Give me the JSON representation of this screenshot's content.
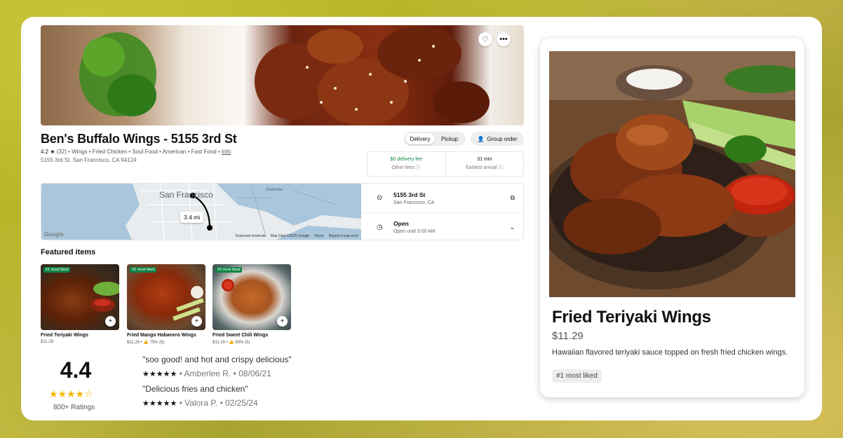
{
  "restaurant": {
    "title": "Ben's Buffalo Wings - 5155 3rd St",
    "rating": "4.2 ★",
    "review_count": "(32)",
    "categories": "• Wings • Fried Chicken • Soul Food • American • Fast Food •",
    "info_link": "Info",
    "address": "5155 3rd St, San Francisco, CA 94124"
  },
  "hero": {
    "favorite_icon": "heart-icon",
    "more_icon": "more-icon"
  },
  "order_mode": {
    "delivery": "Delivery",
    "pickup": "Pickup",
    "selected": "Delivery"
  },
  "group_order": {
    "label": "Group order",
    "icon": "add-person-icon"
  },
  "fees": {
    "delivery_fee": "$0 delivery fee",
    "other_fees": "Other fees",
    "time": "31 min",
    "time_label": "Earliest arrival"
  },
  "map": {
    "city_label": "San Francisco",
    "alameda": "Alameda",
    "distance": "3.4 mi",
    "google": "Google",
    "footer": [
      "Keyboard shortcuts",
      "Map Data ©2025 Google",
      "Terms",
      "Report a map error"
    ]
  },
  "location": {
    "street": "5155 3rd St",
    "city": "San Francisco, CA",
    "hours_status": "Open",
    "hours_detail": "Open until 3:00 AM"
  },
  "featured": {
    "heading": "Featured items",
    "items": [
      {
        "badge": "#1 most liked",
        "name": "Fried Teriyaki Wings",
        "price": "$11.29"
      },
      {
        "badge": "#2 most liked",
        "name": "Fried Mango Habanero Wings",
        "price": "$11.29 • 👍 75% (8)"
      },
      {
        "badge": "#3 most liked",
        "name": "Fried Sweet Chili Wings",
        "price": "$11.29 • 👍 60% (5)"
      }
    ]
  },
  "ratings": {
    "score": "4.4",
    "stars": "★★★★☆",
    "count": "800+ Ratings",
    "reviews": [
      {
        "quote": "\"soo good! and hot and crispy delicious\"",
        "stars": "★★★★★",
        "meta": " • Amberlee R. • 08/06/21"
      },
      {
        "quote": "\"Delicious fries and chicken\"",
        "stars": "★★★★★",
        "meta": " • Valora P. • 02/25/24"
      }
    ]
  },
  "detail": {
    "name": "Fried Teriyaki Wings",
    "price": "$11.29",
    "description": "Hawaiian flavored teriyaki sauce topped on fresh fried chicken wings.",
    "badge": "#1 most liked"
  },
  "colors": {
    "accent_green": "#0e8345",
    "star_gold": "#f5b700"
  }
}
